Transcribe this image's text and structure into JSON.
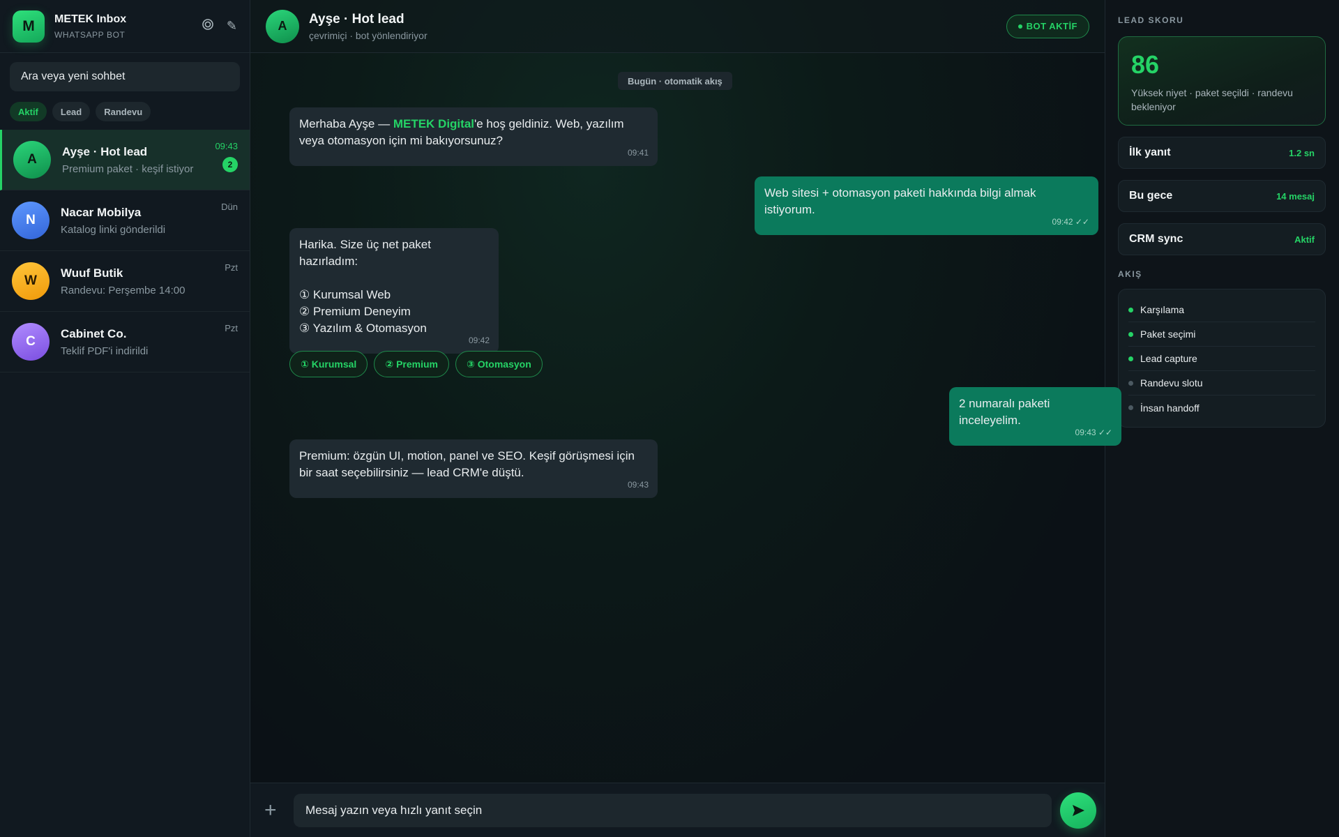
{
  "sidebar": {
    "logo_letter": "M",
    "title": "METEK Inbox",
    "subtitle": "WHATSAPP BOT",
    "search_placeholder": "Ara veya yeni sohbet",
    "chips": [
      "Aktif",
      "Lead",
      "Randevu"
    ],
    "conversations": [
      {
        "initial": "A",
        "name": "Ayşe · Hot lead",
        "preview": "Premium paket · keşif istiyor",
        "time": "09:43",
        "unread": "2"
      },
      {
        "initial": "N",
        "name": "Nacar Mobilya",
        "preview": "Katalog linki gönderildi",
        "time": "Dün"
      },
      {
        "initial": "W",
        "name": "Wuuf Butik",
        "preview": "Randevu: Perşembe 14:00",
        "time": "Pzt"
      },
      {
        "initial": "C",
        "name": "Cabinet Co.",
        "preview": "Teklif PDF'i indirildi",
        "time": "Pzt"
      }
    ]
  },
  "chat": {
    "header": {
      "initial": "A",
      "name": "Ayşe · Hot lead",
      "status": "çevrimiçi · bot yönlendiriyor",
      "badge": "BOT AKTİF"
    },
    "day_label": "Bugün · otomatik akış",
    "messages": [
      {
        "before": "Merhaba Ayşe — ",
        "brand": "METEK Digital",
        "after": "'e hoş geldiniz. Web, yazılım veya otomasyon için mi bakıyorsunuz?",
        "time": "09:41"
      },
      {
        "text": "Web sitesi + otomasyon paketi hakkında bilgi almak istiyorum.",
        "time": "09:42 ✓✓"
      },
      {
        "line1": "Harika. Size üç net paket hazırladım:",
        "line2": "① Kurumsal Web",
        "line3": "② Premium Deneyim",
        "line4": "③ Yazılım & Otomasyon",
        "time": "09:42"
      },
      {
        "text": "2 numaralı paketi inceleyelim.",
        "time": "09:43 ✓✓"
      },
      {
        "text": "Premium: özgün UI, motion, panel ve SEO. Keşif görüşmesi için bir saat seçebilirsiniz — lead CRM'e düştü.",
        "time": "09:43"
      }
    ],
    "quick_replies": [
      "① Kurumsal",
      "② Premium",
      "③ Otomasyon"
    ],
    "composer_placeholder": "Mesaj yazın veya hızlı yanıt seçin"
  },
  "right_panel": {
    "score_label": "LEAD SKORU",
    "score": "86",
    "score_desc": "Yüksek niyet · paket seçildi · randevu bekleniyor",
    "stats": [
      {
        "label": "İlk yanıt",
        "value": "1.2 sn"
      },
      {
        "label": "Bu gece",
        "value": "14 mesaj"
      },
      {
        "label": "CRM sync",
        "value": "Aktif"
      }
    ],
    "flow_label": "AKIŞ",
    "flow": [
      {
        "label": "Karşılama",
        "done": true
      },
      {
        "label": "Paket seçimi",
        "done": true
      },
      {
        "label": "Lead capture",
        "done": true
      },
      {
        "label": "Randevu slotu",
        "done": false
      },
      {
        "label": "İnsan handoff",
        "done": false
      }
    ]
  },
  "colors": {
    "accent": "#25d366",
    "outgoing_bubble": "#0b7a5c",
    "incoming_bubble": "#1f2a31"
  }
}
